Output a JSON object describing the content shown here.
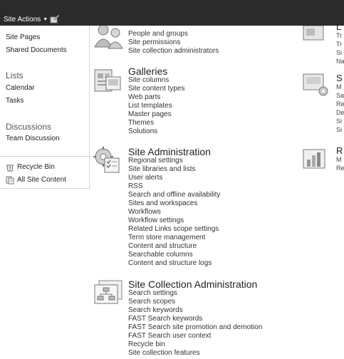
{
  "topbar": {
    "site_actions_label": "Site Actions"
  },
  "quick_launch": {
    "libraries": [
      "Site Pages",
      "Shared Documents"
    ],
    "lists_heading": "Lists",
    "lists": [
      "Calendar",
      "Tasks"
    ],
    "discussions_heading": "Discussions",
    "discussions": [
      "Team Discussion"
    ],
    "recycle_bin": "Recycle Bin",
    "all_site_content": "All Site Content"
  },
  "categories": {
    "users_permissions": {
      "links": [
        "People and groups",
        "Site permissions",
        "Site collection administrators"
      ]
    },
    "galleries": {
      "title": "Galleries",
      "links": [
        "Site columns",
        "Site content types",
        "Web parts",
        "List templates",
        "Master pages",
        "Themes",
        "Solutions"
      ]
    },
    "site_admin": {
      "title": "Site Administration",
      "links": [
        "Regional settings",
        "Site libraries and lists",
        "User alerts",
        "RSS",
        "Search and offline availability",
        "Sites and workspaces",
        "Workflows",
        "Workflow settings",
        "Related Links scope settings",
        "Term store management",
        "Content and structure",
        "Searchable columns",
        "Content and structure logs"
      ]
    },
    "site_collection_admin": {
      "title": "Site Collection Administration",
      "links": [
        "Search settings",
        "Search scopes",
        "Search keywords",
        "FAST Search keywords",
        "FAST Search site promotion and demotion",
        "FAST Search user context",
        "Recycle bin",
        "Site collection features"
      ]
    }
  },
  "right_column_fragments": {
    "c1": [
      "L",
      "Tr",
      "Tr",
      "Si",
      "Na"
    ],
    "c2": [
      "S",
      "M",
      "Sa",
      "Re",
      "De",
      "Si",
      "Si"
    ],
    "c3": [
      "R",
      "M",
      "Re"
    ]
  }
}
